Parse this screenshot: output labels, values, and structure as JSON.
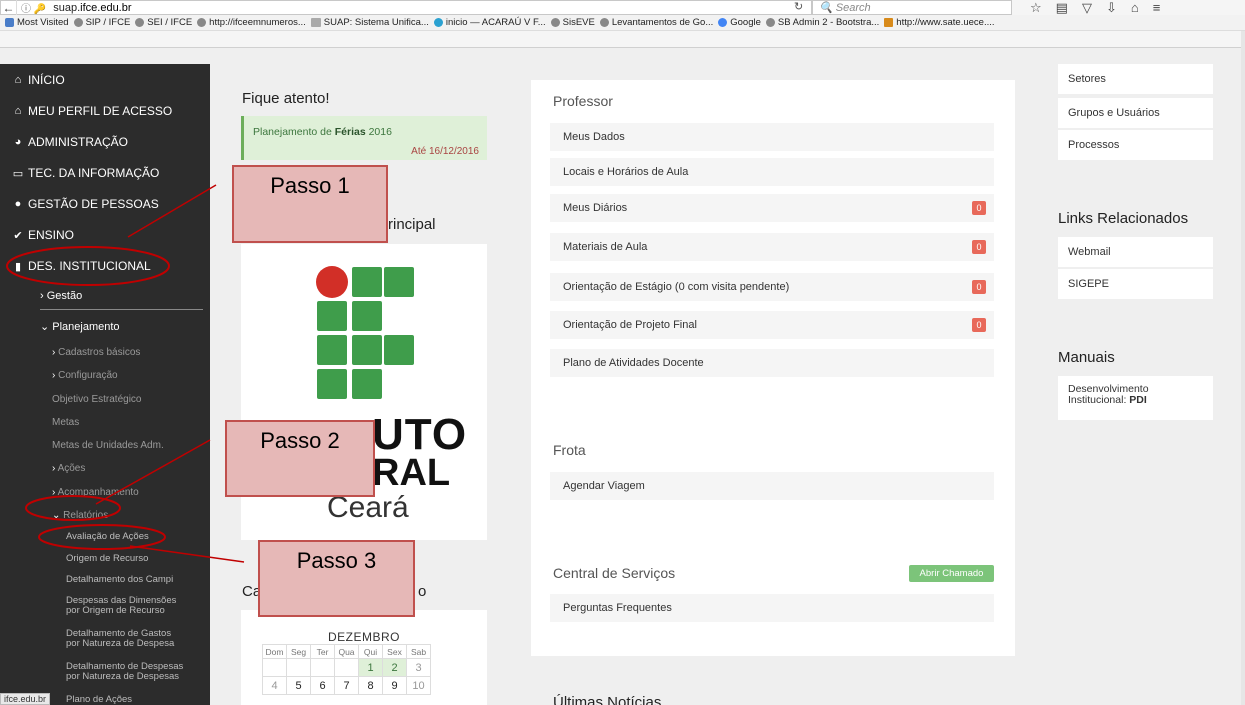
{
  "browser": {
    "url_prefix": "suap.",
    "url_domain": "ifce.edu.br",
    "search_placeholder": "Search",
    "bookmarks": [
      "Most Visited",
      "SIP / IFCE",
      "SEI / IFCE",
      "http://ifceemnumeros...",
      "SUAP: Sistema Unifica...",
      "inicio — ACARAÚ V F...",
      "SisEVE",
      "Levantamentos de Go...",
      "Google",
      "SB Admin 2 - Bootstra...",
      "http://www.sate.uece...."
    ],
    "status_text": "ifce.edu.br"
  },
  "sidebar": {
    "inicio": "INÍCIO",
    "meu_perfil": "MEU PERFIL DE ACESSO",
    "administracao": "ADMINISTRAÇÃO",
    "tec_info": "TEC. DA INFORMAÇÃO",
    "gestao_pessoas": "GESTÃO DE PESSOAS",
    "ensino": "ENSINO",
    "des_inst": "DES. INSTITUCIONAL",
    "gestao": "Gestão",
    "planejamento": "Planejamento",
    "cadastros": "Cadastros básicos",
    "configuracao": "Configuração",
    "objetivo": "Objetivo Estratégico",
    "metas": "Metas",
    "metas_unidades": "Metas de Unidades Adm.",
    "acoes": "Ações",
    "acompanhamento": "Acompanhamento",
    "relatorios": "Relatórios",
    "avaliacao": "Avaliação de Ações",
    "origem": "Origem de Recurso",
    "detalhamento_campi": "Detalhamento dos Campi",
    "despesas_dim_1": "Despesas das Dimensões",
    "despesas_dim_2": "por Origem de Recurso",
    "det_gastos_1": "Detalhamento de Gastos",
    "det_gastos_2": "por Natureza de Despesa",
    "det_despesas_1": "Detalhamento de Despesas",
    "det_despesas_2": "por Natureza de Despesas",
    "plano_acoes": "Plano de Ações"
  },
  "left": {
    "fique_title": "Fique atento!",
    "alert_prefix": "Planejamento de ",
    "alert_bold": "Férias",
    "alert_suffix": " 2016",
    "alert_date": "Até 16/12/2016",
    "principal": "rincipal",
    "logo_line1": "UTO",
    "logo_line2": "RAL",
    "logo_line3": "Ceará",
    "cal_c": "Ca",
    "cal_o": "o",
    "cal_month": "DEZEMBRO",
    "cal_days": [
      "Dom",
      "Seg",
      "Ter",
      "Qua",
      "Qui",
      "Sex",
      "Sab"
    ],
    "cal_row1": [
      "",
      "",
      "",
      "",
      "1",
      "2",
      "3"
    ],
    "cal_row2": [
      "4",
      "5",
      "6",
      "7",
      "8",
      "9",
      "10"
    ]
  },
  "middle": {
    "professor_title": "Professor",
    "meus_dados": "Meus Dados",
    "locais": "Locais e Horários de Aula",
    "meus_diarios": "Meus Diários",
    "materiais": "Materiais de Aula",
    "orientacao_estagio": "Orientação de Estágio (0 com visita pendente)",
    "orientacao_projeto": "Orientação de Projeto Final",
    "plano_atividades": "Plano de Atividades Docente",
    "badge_zero": "0",
    "frota_title": "Frota",
    "agendar": "Agendar Viagem",
    "central_title": "Central de Serviços",
    "abrir_chamado": "Abrir Chamado",
    "perguntas": "Perguntas Frequentes",
    "ultimas": "Últimas Notícias"
  },
  "right": {
    "setores": "Setores",
    "grupos": "Grupos e Usuários",
    "processos": "Processos",
    "links_title": "Links Relacionados",
    "webmail": "Webmail",
    "sigepe": "SIGEPE",
    "manuais_title": "Manuais",
    "desenv_1": "Desenvolvimento",
    "desenv_2": "Institucional: ",
    "desenv_bold": "PDI"
  },
  "annotations": {
    "passo1": "Passo 1",
    "passo2": "Passo 2",
    "passo3": "Passo 3"
  },
  "colors": {
    "sidebar_bg": "#2c2c2c",
    "green_accent": "#3f9d4b",
    "red_logo": "#d22f27",
    "badge_red": "#e8695a",
    "annotation_fill": "#e6b8b7",
    "annotation_stroke": "#c00000"
  }
}
